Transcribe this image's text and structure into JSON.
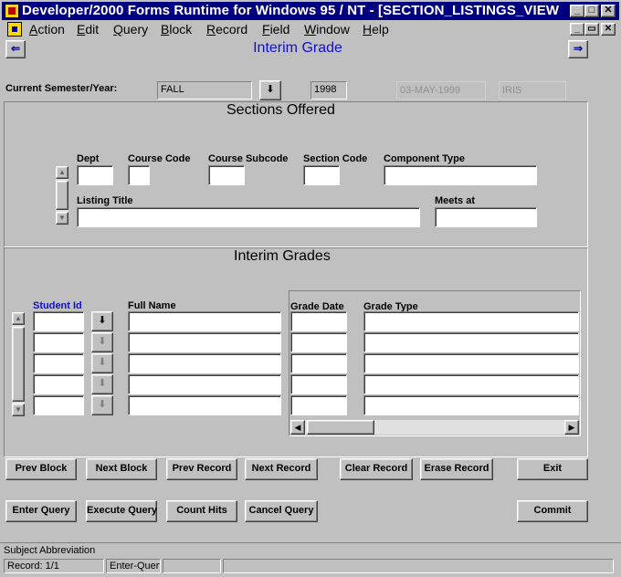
{
  "window": {
    "title": "Developer/2000 Forms Runtime for Windows 95 / NT - [SECTION_LISTINGS_VIEW",
    "minimize": "_",
    "maximize": "□",
    "close": "✕",
    "mdi_minimize": "_",
    "mdi_restore": "▭",
    "mdi_close": "✕"
  },
  "menu": [
    "Action",
    "Edit",
    "Query",
    "Block",
    "Record",
    "Field",
    "Window",
    "Help"
  ],
  "form": {
    "title": "Interim Grade",
    "prev_icon": "⇐",
    "next_icon": "⇒"
  },
  "header": {
    "semester_label": "Current Semester/Year:",
    "semester_value": "FALL",
    "lov_icon": "⬇",
    "year_value": "1998",
    "date_value": "03-MAY-1999",
    "user_value": "IRIS"
  },
  "sections": {
    "frame_title": "Sections Offered",
    "labels": {
      "dept": "Dept",
      "course_code": "Course Code",
      "course_subcode": "Course Subcode",
      "section_code": "Section Code",
      "component_type": "Component Type",
      "listing_title": "Listing Title",
      "meets_at": "Meets at"
    }
  },
  "grades": {
    "frame_title": "Interim Grades",
    "labels": {
      "student_id": "Student Id",
      "full_name": "Full Name",
      "grade_date": "Grade Date",
      "grade_type": "Grade Type"
    },
    "row_count": 5,
    "hscroll_left": "◀",
    "hscroll_right": "▶"
  },
  "accent_colors": {
    "title_bar": "#000080",
    "form_title": "#1010d0",
    "student_id_label": "#1010d0"
  },
  "buttons": {
    "prev_block": "Prev Block",
    "next_block": "Next Block",
    "prev_record": "Prev Record",
    "next_record": "Next Record",
    "clear_record": "Clear Record",
    "erase_record": "Erase Record",
    "exit": "Exit",
    "enter_query": "Enter Query",
    "execute_query": "Execute Query",
    "count_hits": "Count Hits",
    "cancel_query": "Cancel Query",
    "commit": "Commit"
  },
  "status": {
    "message": "Subject Abbreviation",
    "record": "Record: 1/1",
    "mode": "Enter-Query"
  }
}
